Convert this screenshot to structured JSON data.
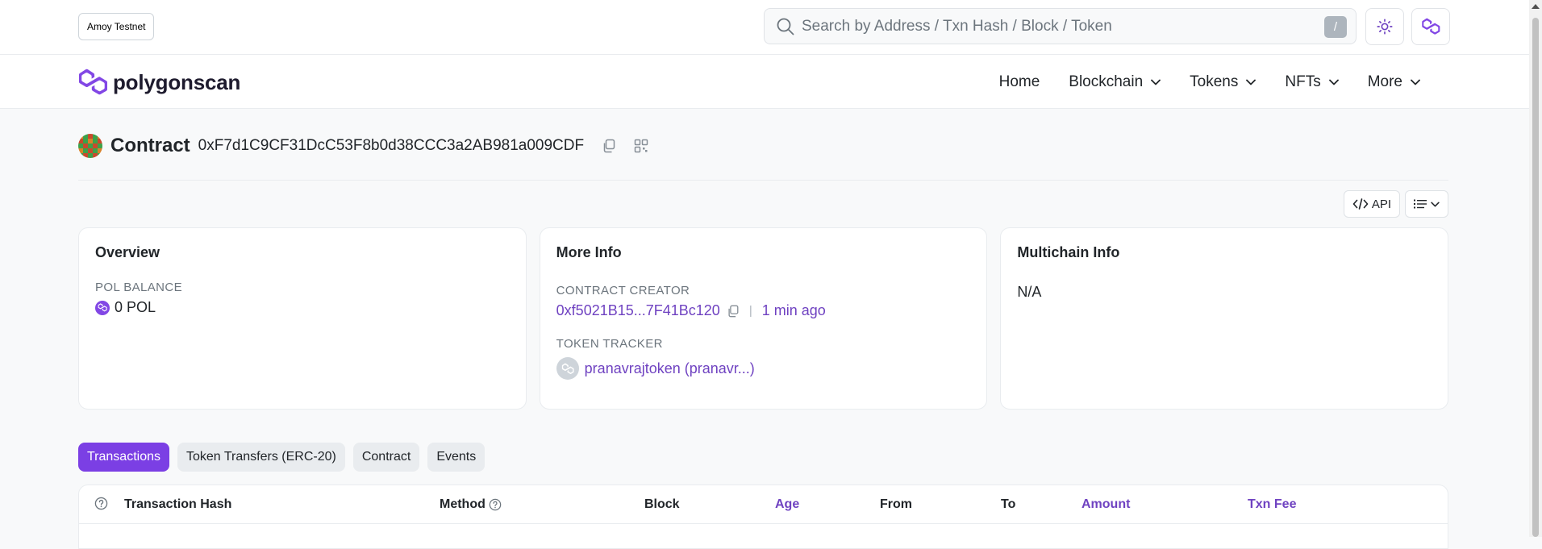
{
  "topbar": {
    "network": "Amoy Testnet",
    "search_placeholder": "Search by Address / Txn Hash / Block / Token",
    "slash_key": "/"
  },
  "navbar": {
    "logo_text": "polygonscan",
    "items": [
      {
        "label": "Home",
        "dropdown": false
      },
      {
        "label": "Blockchain",
        "dropdown": true
      },
      {
        "label": "Tokens",
        "dropdown": true
      },
      {
        "label": "NFTs",
        "dropdown": true
      },
      {
        "label": "More",
        "dropdown": true
      }
    ]
  },
  "header": {
    "title": "Contract",
    "address": "0xF7d1C9CF31DcC53F8b0d38CCC3a2AB981a009CDF"
  },
  "tools": {
    "api_label": "API"
  },
  "overview": {
    "title": "Overview",
    "balance_label": "POL BALANCE",
    "balance_value": "0 POL"
  },
  "more_info": {
    "title": "More Info",
    "creator_label": "CONTRACT CREATOR",
    "creator_address": "0xf5021B15...7F41Bc120",
    "separator": "|",
    "creator_age": "1 min ago",
    "tracker_label": "TOKEN TRACKER",
    "tracker_value": "pranavrajtoken (pranavr...)"
  },
  "multichain": {
    "title": "Multichain Info",
    "value": "N/A"
  },
  "tabs": [
    "Transactions",
    "Token Transfers (ERC-20)",
    "Contract",
    "Events"
  ],
  "table": {
    "columns": [
      "Transaction Hash",
      "Method",
      "Block",
      "Age",
      "From",
      "To",
      "Amount",
      "Txn Fee"
    ]
  },
  "colors": {
    "accent": "#7b3fe4",
    "link": "#6f42c1",
    "brand": "#8247e5"
  }
}
